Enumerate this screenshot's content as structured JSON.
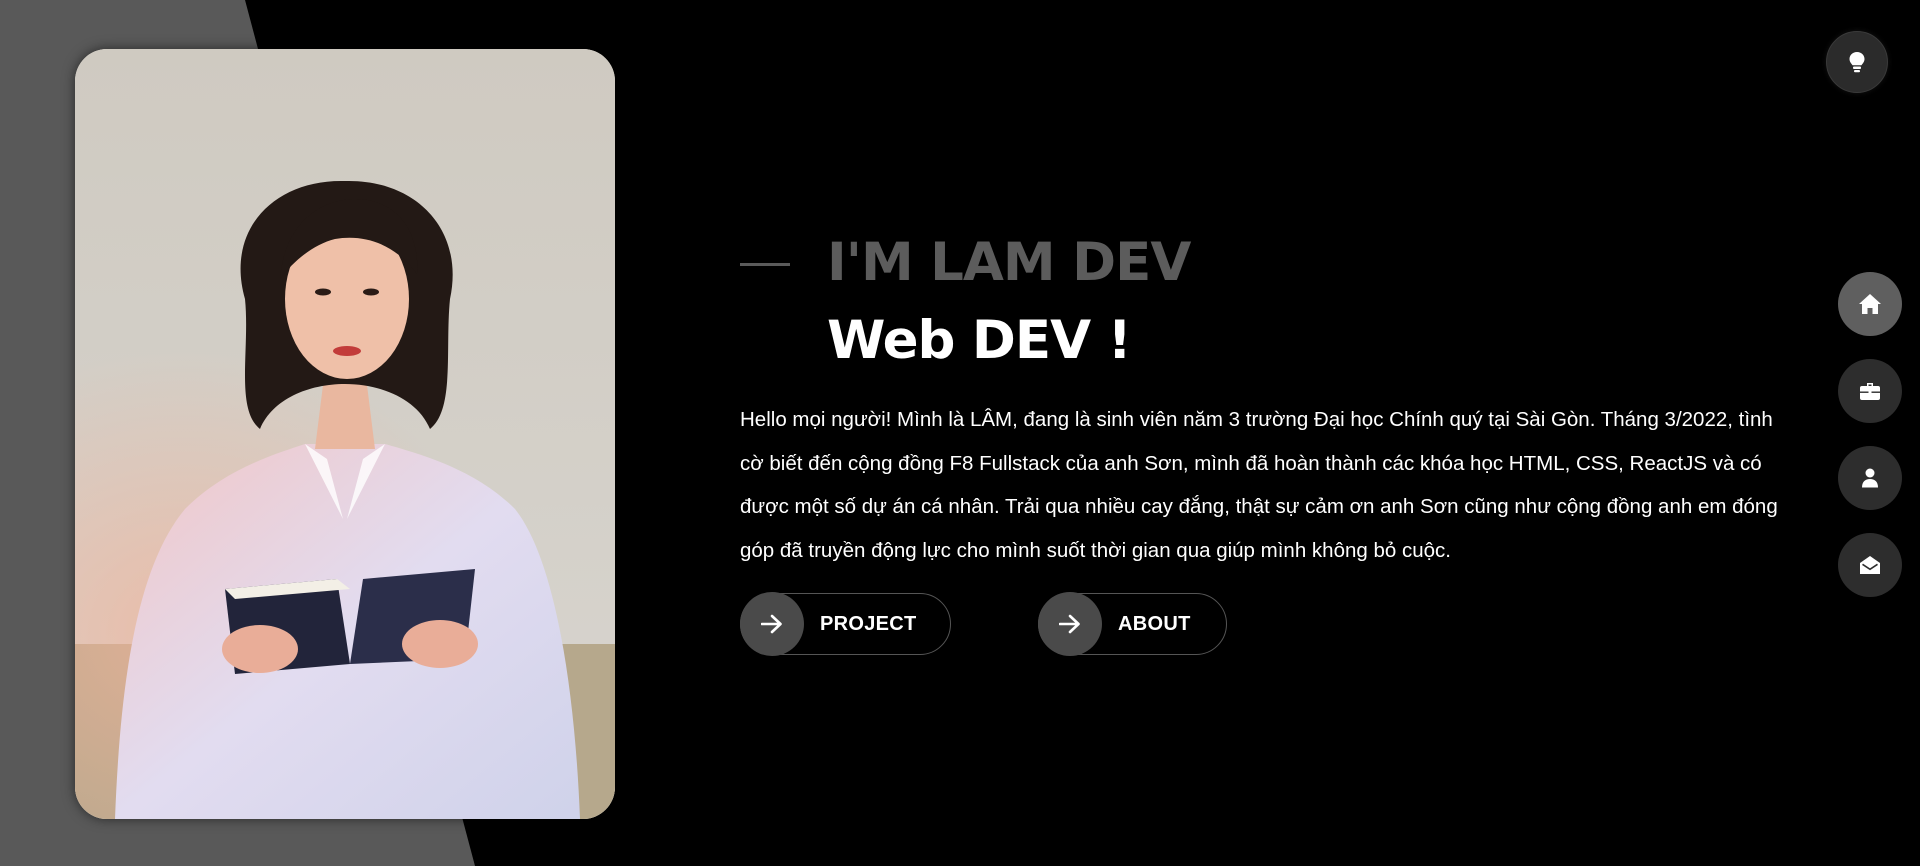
{
  "hero": {
    "intro": "I'M LAM DEV",
    "role": "Web DEV !",
    "bio": "Hello mọi người! Mình là LÂM, đang là sinh viên năm 3 trường Đại học Chính quý tại Sài Gòn. Tháng 3/2022, tình cờ biết đến cộng đồng F8 Fullstack của anh Sơn, mình đã hoàn thành các khóa học HTML, CSS, ReactJS và có được một số dự án cá nhân. Trải qua nhiều cay đắng, thật sự cảm ơn anh Sơn cũng như cộng đồng anh em đóng góp đã truyền động lực cho mình suốt thời gian qua giúp mình không bỏ cuộc."
  },
  "buttons": {
    "project_label": "PROJECT",
    "about_label": "ABOUT",
    "icon": "arrow-right-icon"
  },
  "theme_toggle": {
    "icon": "lightbulb-icon"
  },
  "side_nav": [
    {
      "id": "home",
      "icon": "home-icon",
      "active": true
    },
    {
      "id": "portfolio",
      "icon": "briefcase-icon",
      "active": false
    },
    {
      "id": "about",
      "icon": "user-icon",
      "active": false
    },
    {
      "id": "contact",
      "icon": "envelope-open-icon",
      "active": false
    }
  ],
  "colors": {
    "background": "#000000",
    "panel": "#595959",
    "intro_text": "#5c5c5c",
    "text": "#ffffff",
    "button_circle": "#4a4a4a",
    "nav_inactive": "#2d2d2d",
    "nav_active": "#5f5f5f"
  }
}
